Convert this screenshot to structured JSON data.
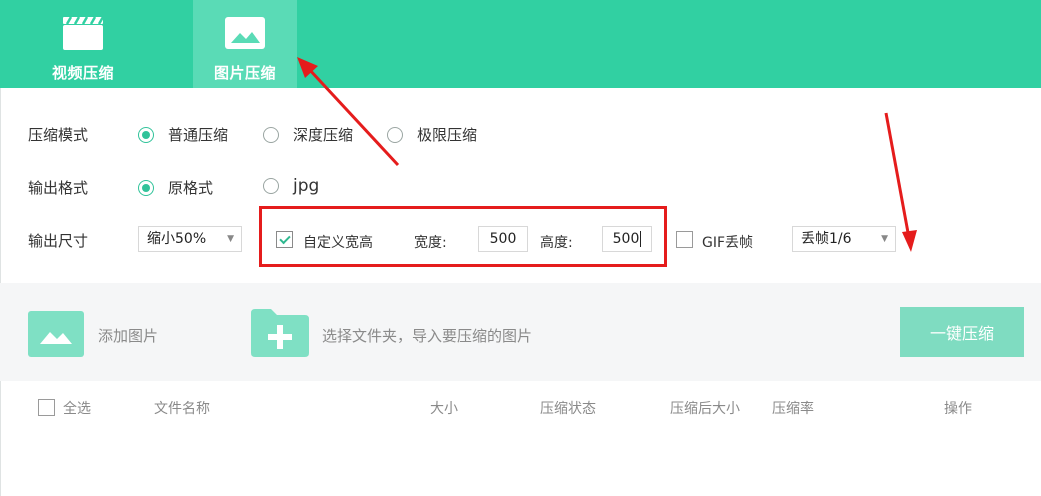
{
  "tabs": [
    {
      "label": "视频压缩",
      "icon": "video-clapperboard-icon",
      "active": false
    },
    {
      "label": "图片压缩",
      "icon": "image-icon",
      "active": true
    }
  ],
  "options": {
    "mode": {
      "label": "压缩模式",
      "choices": [
        "普通压缩",
        "深度压缩",
        "极限压缩"
      ],
      "selected": "普通压缩"
    },
    "format": {
      "label": "输出格式",
      "choices": [
        "原格式",
        "jpg"
      ],
      "selected": "原格式"
    },
    "size": {
      "label": "输出尺寸",
      "scale_value": "缩小50%",
      "custom_label": "自定义宽高",
      "custom_checked": true,
      "width_label": "宽度:",
      "width_value": "500",
      "height_label": "高度:",
      "height_value": "500",
      "gif_label": "GIF丢帧",
      "gif_checked": false,
      "gif_value": "丢帧1/6"
    }
  },
  "actions": {
    "add_image": "添加图片",
    "choose_folder": "选择文件夹，导入要压缩的图片",
    "compress_all": "一键压缩"
  },
  "table": {
    "select_all": "全选",
    "columns": [
      "文件名称",
      "大小",
      "压缩状态",
      "压缩后大小",
      "压缩率",
      "操作"
    ]
  },
  "colors": {
    "brand": "#31d0a2",
    "tab_active": "#5adbb6",
    "button": "#7fdcc1",
    "annotation": "#e51c1c"
  }
}
